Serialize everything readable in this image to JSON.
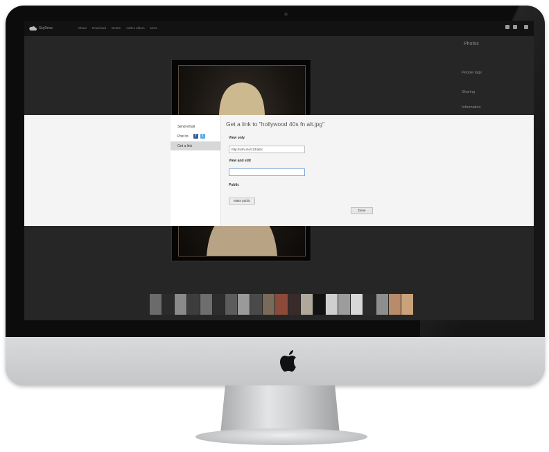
{
  "app_bar": {
    "brand": "SkyDrive",
    "nav": [
      "Share",
      "Download",
      "Delete",
      "Add to album",
      "More"
    ],
    "user": ""
  },
  "side_panel": {
    "title": "Photos",
    "sub1": "",
    "sub2": "",
    "section1": "People tags",
    "section1_sub": "",
    "section2": "Sharing",
    "section3": "Information",
    "section3_sub": ""
  },
  "album_label": "",
  "dialog": {
    "menu": {
      "send_email": "Send email",
      "post_to": "Post to",
      "get_a_link": "Get a link"
    },
    "terms_link": "",
    "title": "Get a link to \"hollywood 40s fn alt.jpg\"",
    "view_only": {
      "label": "View only",
      "desc": "",
      "link": "http://sdrv.ms/1234abc"
    },
    "view_and_edit": {
      "label": "View and edit",
      "desc": "",
      "link": ""
    },
    "public": {
      "label": "Public",
      "desc": ""
    },
    "make_public_button": "Make public",
    "done_button": "Done"
  },
  "colors": {
    "screen_bg": "#262626",
    "overlay_bg": "#f4f4f4",
    "accent_selection": "#3b78c3",
    "facebook": "#3b5998",
    "twitter": "#55acee"
  }
}
